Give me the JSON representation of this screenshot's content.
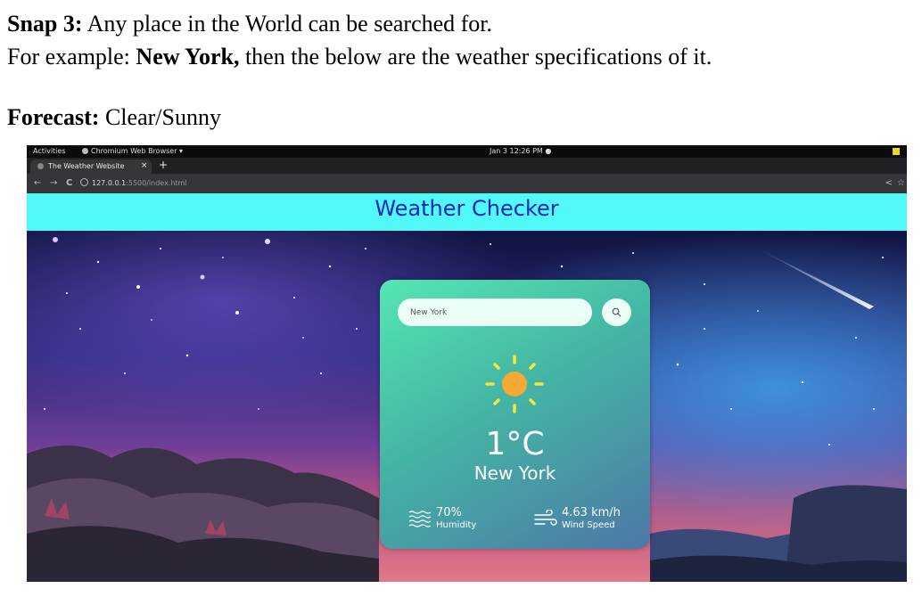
{
  "document": {
    "line1": {
      "bold": "Snap 3:",
      "text": " Any place in the World can be searched for."
    },
    "line2": {
      "pre": "For example: ",
      "bold": "New York,",
      "post": " then the below are the weather specifications of it."
    },
    "line3": {
      "bold": "Forecast:",
      "text": " Clear/Sunny"
    }
  },
  "os_bar": {
    "activities": "Activities",
    "browser_name": "Chromium Web Browser ▾",
    "clock": "Jan 3  12:26 PM  ●"
  },
  "browser": {
    "tab_title": "The Weather Website",
    "tab_close": "×",
    "new_tab": "+",
    "back": "←",
    "forward": "→",
    "reload": "C",
    "url_host": "127.0.0.1",
    "url_path": ":5500/index.html",
    "share_icon": "share-icon",
    "bookmark_icon": "star-icon"
  },
  "site": {
    "title": "Weather Checker",
    "header_color": "#52f9f9",
    "title_color": "#1026c4"
  },
  "weather": {
    "search_value": "New York",
    "icon": "sun-icon",
    "temperature": "1°C",
    "city": "New York",
    "humidity_value": "70%",
    "humidity_label": "Humidity",
    "wind_value": "4.63 km/h",
    "wind_label": "Wind Speed"
  }
}
